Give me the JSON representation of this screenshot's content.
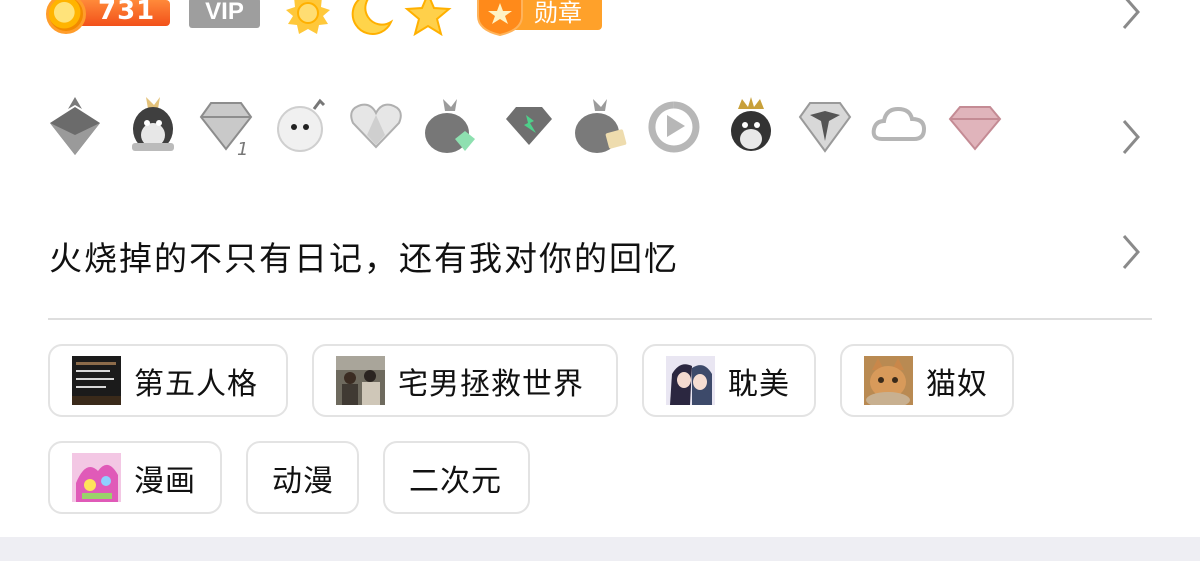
{
  "profile": {
    "level_value": "731",
    "vip_label": "VIP",
    "medal_label": "勋章",
    "level_icons": [
      "sun-icon",
      "moon-icon",
      "star-icon"
    ],
    "medal_icon": "medal-shield-icon"
  },
  "achievements": {
    "icons": [
      "grey-crown-penguin-icon",
      "golden-hat-penguin-icon",
      "diamond-icon",
      "bomb-face-icon",
      "heart-gem-icon",
      "green-gem-penguin-icon",
      "green-diamond-icon",
      "gold-card-penguin-icon",
      "play-button-icon",
      "king-penguin-icon",
      "silver-star-diamond-icon",
      "cloud-icon",
      "pink-diamond-icon"
    ],
    "diamond_subscript": "1"
  },
  "signature": {
    "text": "火烧掉的不只有日记，还有我对你的回忆"
  },
  "tags": [
    {
      "label": "第五人格",
      "has_thumb": true,
      "thumb": "dark-game-thumbnail"
    },
    {
      "label": "宅男拯救世界",
      "has_thumb": true,
      "thumb": "group-photo-thumbnail"
    },
    {
      "label": "耽美",
      "has_thumb": true,
      "thumb": "anime-couple-thumbnail"
    },
    {
      "label": "猫奴",
      "has_thumb": true,
      "thumb": "orange-cat-thumbnail"
    },
    {
      "label": "漫画",
      "has_thumb": true,
      "thumb": "pink-manga-thumbnail"
    },
    {
      "label": "动漫",
      "has_thumb": false
    },
    {
      "label": "二次元",
      "has_thumb": false
    }
  ],
  "colors": {
    "accent_orange": "#f2501a",
    "medal_orange": "#ffa12a",
    "vip_grey": "#9e9e9e",
    "chip_border": "#e3e3e3",
    "divider": "#dedede"
  }
}
